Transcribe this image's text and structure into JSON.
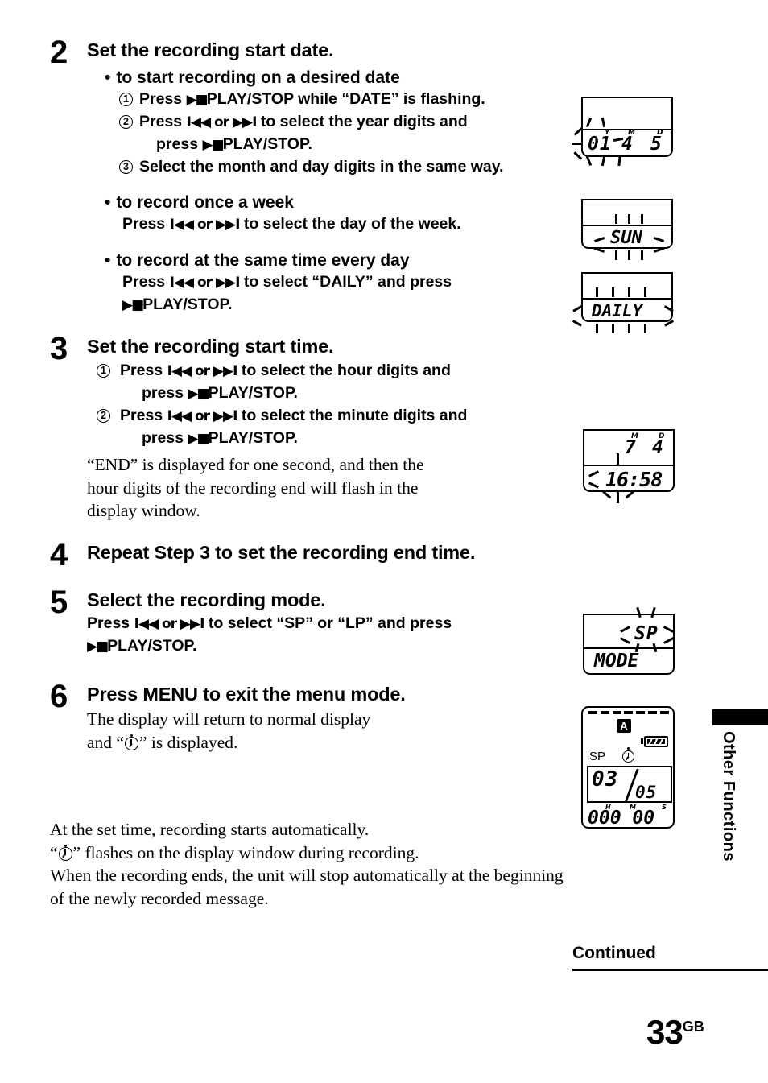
{
  "page": {
    "number": "33",
    "number_suffix": "GB",
    "continued_label": "Continued",
    "side_tab_label": "Other Functions"
  },
  "steps": [
    {
      "number": "2",
      "heading": "Set the recording start date.",
      "bullets": [
        {
          "title": "to start recording on a desired date",
          "items": [
            {
              "marker": "1",
              "line1_a": "Press ",
              "glyph": "play-stop",
              "line1_b": "PLAY/STOP while “DATE” is flashing."
            },
            {
              "marker": "2",
              "line1_a": "Press ",
              "glyph": "prev-next",
              "line1_b": " to select the year digits and",
              "line2_a": "press ",
              "line2_glyph": "play-stop",
              "line2_b": "PLAY/STOP."
            },
            {
              "marker": "3",
              "line1_a": "Select the month and day digits in the same way.",
              "glyph": "",
              "line1_b": ""
            }
          ]
        },
        {
          "title": "to record once a week",
          "text_a": "Press ",
          "text_glyph": "prev-next",
          "text_b": " to select the day of the week."
        },
        {
          "title": "to record at the same time every day",
          "text_a": "Press ",
          "text_glyph": "prev-next",
          "text_b": " to select “DAILY” and press",
          "text_line2_glyph": "play-stop",
          "text_line2_b": "PLAY/STOP."
        }
      ]
    },
    {
      "number": "3",
      "heading": "Set the recording start time.",
      "items": [
        {
          "marker": "1",
          "a": "Press ",
          "glyph": "prev-next",
          "b": " to select the hour digits and",
          "c_a": "press ",
          "c_glyph": "play-stop",
          "c_b": "PLAY/STOP."
        },
        {
          "marker": "2",
          "a": "Press ",
          "glyph": "prev-next",
          "b": " to select the minute digits and",
          "c_a": "press ",
          "c_glyph": "play-stop",
          "c_b": "PLAY/STOP."
        }
      ],
      "note": [
        "“END” is displayed for one second, and then the",
        "hour digits of the recording end will flash in the",
        "display window."
      ]
    },
    {
      "number": "4",
      "heading": "Repeat Step 3 to set the recording end time."
    },
    {
      "number": "5",
      "heading": "Select the recording mode.",
      "sub_a": "Press ",
      "sub_glyph": "prev-next",
      "sub_b": " to select “SP” or “LP” and press",
      "sub_line2_glyph": "play-stop",
      "sub_line2_b": "PLAY/STOP."
    },
    {
      "number": "6",
      "heading": "Press MENU to exit the menu mode.",
      "note_line1": "The display will return to normal display",
      "note_line2_a": "and “",
      "note_line2_b": "” is displayed."
    }
  ],
  "closing": [
    "At the set time, recording starts automatically.",
    "“⊙” flashes on the display window during recording.",
    "When the recording ends, the unit will stop automatically at the beginning",
    "of the newly recorded message."
  ],
  "closing_line2_a": "“",
  "closing_line2_b": "” flashes on the display window during recording.",
  "lcd": {
    "date": {
      "name": "date-display",
      "year": "01",
      "month": "4",
      "day": "5",
      "label_y": "Y",
      "label_m": "M",
      "label_d": "D"
    },
    "weekday": {
      "name": "weekday-display",
      "value": "SUN"
    },
    "daily": {
      "name": "daily-display",
      "value": "DAILY"
    },
    "time": {
      "name": "start-time-display",
      "month": "7",
      "day": "4",
      "label_m": "M",
      "label_d": "D",
      "time": "16:58"
    },
    "mode": {
      "name": "recording-mode-display",
      "value": "SP",
      "label": "MODE"
    },
    "normal": {
      "name": "normal-display",
      "folder": "A",
      "mode": "SP",
      "message_current": "03",
      "message_total": "05",
      "counter": "000 00",
      "label_h": "H",
      "label_m": "M",
      "label_s": "S"
    }
  }
}
